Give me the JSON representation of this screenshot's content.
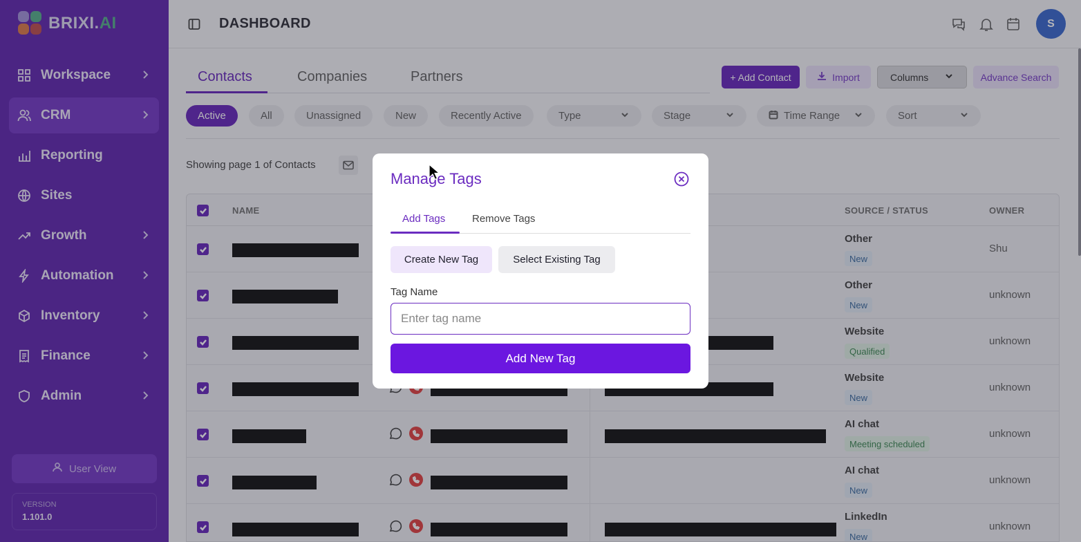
{
  "app": {
    "logo_text": "BRIXI.",
    "logo_suffix": "AI",
    "page_title": "DASHBOARD",
    "avatar_initial": "S"
  },
  "sidebar": {
    "items": [
      {
        "label": "Workspace",
        "icon": "grid-icon",
        "chevron": true
      },
      {
        "label": "CRM",
        "icon": "users-icon",
        "chevron": true,
        "active": true
      },
      {
        "label": "Reporting",
        "icon": "bar-chart-icon",
        "chevron": false
      },
      {
        "label": "Sites",
        "icon": "globe-icon",
        "chevron": false
      },
      {
        "label": "Growth",
        "icon": "trend-up-icon",
        "chevron": true
      },
      {
        "label": "Automation",
        "icon": "bolt-icon",
        "chevron": true
      },
      {
        "label": "Inventory",
        "icon": "box-icon",
        "chevron": true
      },
      {
        "label": "Finance",
        "icon": "receipt-icon",
        "chevron": true
      },
      {
        "label": "Admin",
        "icon": "shield-icon",
        "chevron": true
      }
    ],
    "user_view_label": "User View",
    "version_label": "VERSION",
    "version_value": "1.101.0"
  },
  "main": {
    "tabs": [
      "Contacts",
      "Companies",
      "Partners"
    ],
    "actions": {
      "add_contact": "+ Add Contact",
      "import": "Import",
      "columns": "Columns",
      "advance_search": "Advance Search"
    },
    "filters": [
      "Active",
      "All",
      "Unassigned",
      "New",
      "Recently Active"
    ],
    "dropdown_filters": [
      "Type",
      "Stage",
      "Time Range",
      "Sort"
    ],
    "showing_text": "Showing page 1 of Contacts"
  },
  "table": {
    "headers": {
      "name": "NAME",
      "source_status": "SOURCE / STATUS",
      "owner": "OWNER"
    },
    "rows": [
      {
        "source": "Other",
        "status": "New",
        "status_color": "blue",
        "owner": "Shu"
      },
      {
        "source": "Other",
        "status": "New",
        "status_color": "blue",
        "owner": "unknown"
      },
      {
        "source": "Website",
        "status": "Qualified",
        "status_color": "green",
        "owner": "unknown"
      },
      {
        "source": "Website",
        "status": "New",
        "status_color": "blue",
        "owner": "unknown"
      },
      {
        "source": "AI chat",
        "status": "Meeting scheduled",
        "status_color": "green",
        "owner": "unknown"
      },
      {
        "source": "AI chat",
        "status": "New",
        "status_color": "blue",
        "owner": "unknown"
      },
      {
        "source": "LinkedIn",
        "status": "New",
        "status_color": "blue",
        "owner": "unknown"
      }
    ]
  },
  "modal": {
    "title": "Manage Tags",
    "tabs": {
      "add": "Add Tags",
      "remove": "Remove Tags"
    },
    "segments": {
      "create": "Create New Tag",
      "select": "Select Existing Tag"
    },
    "field_label": "Tag Name",
    "input_value": "",
    "input_placeholder": "Enter tag name",
    "submit_label": "Add New Tag"
  },
  "colors": {
    "sidebar_bg": "#5417a8",
    "accent": "#5b17b5",
    "button_primary": "#6b17e0"
  }
}
